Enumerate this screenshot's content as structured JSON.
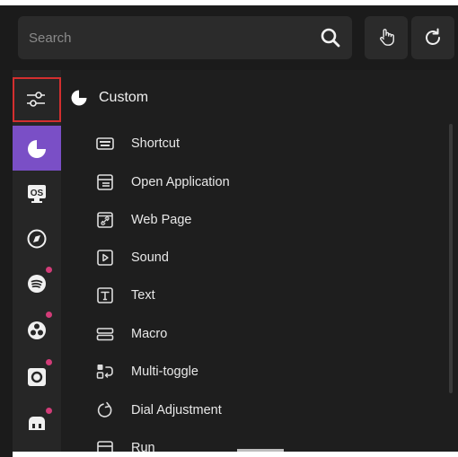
{
  "caption": {
    "text": "...g... ...page"
  },
  "topbar": {
    "search_placeholder": "Search",
    "icons": [
      "search-icon",
      "hand-pointer-icon",
      "refresh-icon"
    ]
  },
  "rail": {
    "items": [
      {
        "name": "settings-sliders",
        "icon": "sliders-icon",
        "outlined": true
      },
      {
        "name": "custom",
        "icon": "custom-logo-icon",
        "active": true
      },
      {
        "name": "os",
        "icon": "os-icon",
        "dot": false
      },
      {
        "name": "safari",
        "icon": "compass-icon",
        "dot": false
      },
      {
        "name": "spotify",
        "icon": "spotify-icon",
        "dot": true
      },
      {
        "name": "obs",
        "icon": "obs-icon",
        "dot": true
      },
      {
        "name": "camera",
        "icon": "camera-icon",
        "dot": true
      },
      {
        "name": "twitch",
        "icon": "twitch-icon",
        "dot": true
      }
    ],
    "accent": "#7a4fc6",
    "dot_color": "#d23c78",
    "outline_color": "#d32f2f"
  },
  "content": {
    "section_title": "Custom",
    "items": [
      {
        "label": "Shortcut",
        "icon": "keyboard-icon"
      },
      {
        "label": "Open Application",
        "icon": "window-icon"
      },
      {
        "label": "Web Page",
        "icon": "link-page-icon"
      },
      {
        "label": "Sound",
        "icon": "play-box-icon"
      },
      {
        "label": "Text",
        "icon": "text-box-icon"
      },
      {
        "label": "Macro",
        "icon": "macro-icon"
      },
      {
        "label": "Multi-toggle",
        "icon": "multi-toggle-icon"
      },
      {
        "label": "Dial Adjustment",
        "icon": "dial-icon"
      },
      {
        "label": "Run",
        "icon": "run-icon"
      }
    ]
  }
}
